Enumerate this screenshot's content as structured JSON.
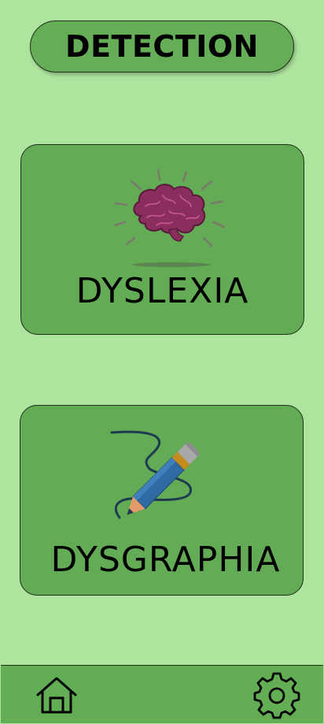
{
  "header": {
    "title": "DETECTION"
  },
  "cards": [
    {
      "label": "DYSLEXIA",
      "icon": "brain-icon"
    },
    {
      "label": "DYSGRAPHIA",
      "icon": "pencil-icon"
    }
  ],
  "bottom_nav": {
    "items": [
      {
        "icon": "home-icon"
      },
      {
        "icon": "gear-icon"
      }
    ]
  },
  "colors": {
    "background": "#ade49e",
    "card": "#64ab56",
    "brain": "#8a2e5e",
    "pencil": "#2f6aa3"
  }
}
